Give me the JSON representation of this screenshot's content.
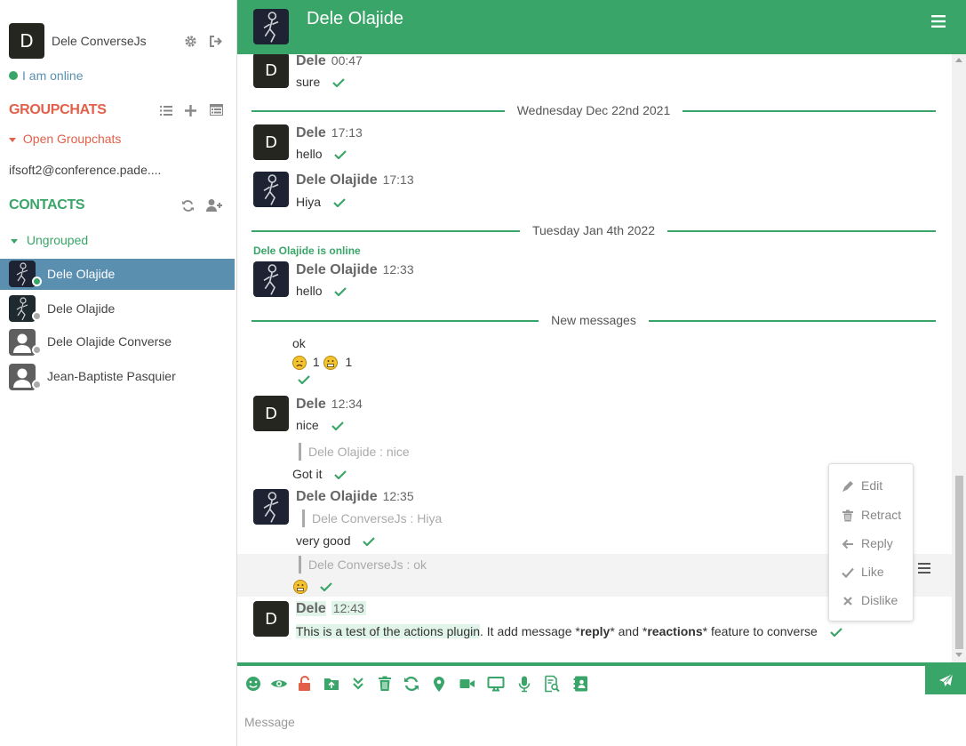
{
  "sidebar": {
    "user": {
      "avatar_letter": "D",
      "name": "Dele ConverseJs"
    },
    "status": {
      "label": "I am online",
      "color": "#3aa569"
    },
    "groupchats": {
      "title": "GROUPCHATS",
      "open_label": "Open Groupchats",
      "rooms": [
        "ifsoft2@conference.pade...."
      ]
    },
    "contacts": {
      "title": "CONTACTS",
      "group_label": "Ungrouped",
      "items": [
        {
          "name": "Dele Olajide",
          "active": true,
          "status": "online"
        },
        {
          "name": "Dele Olajide",
          "active": false,
          "status": "offline"
        },
        {
          "name": "Dele Olajide Converse",
          "active": false,
          "status": "offline"
        },
        {
          "name": "Jean-Baptiste Pasquier",
          "active": false,
          "status": "offline"
        }
      ]
    }
  },
  "chat": {
    "title": "Dele Olajide",
    "messages": {
      "m0": {
        "author": "Dele",
        "time": "00:47",
        "text": "sure"
      },
      "sep1": "Wednesday Dec 22nd 2021",
      "m1": {
        "author": "Dele",
        "time": "17:13",
        "text": "hello"
      },
      "m2": {
        "author": "Dele Olajide",
        "time": "17:13",
        "text": "Hiya"
      },
      "sep2": "Tuesday Jan 4th 2022",
      "presence": "Dele Olajide is online",
      "m3": {
        "author": "Dele Olajide",
        "time": "12:33",
        "text": "hello"
      },
      "sep3": "New messages",
      "m4": {
        "text": "ok",
        "reaction1_count": "1",
        "reaction2_count": "1"
      },
      "m5": {
        "author": "Dele",
        "time": "12:34",
        "text": "nice"
      },
      "m6": {
        "quote": "Dele Olajide : nice",
        "text": "Got it"
      },
      "m7": {
        "author": "Dele Olajide",
        "time": "12:35",
        "quote": "Dele ConverseJs : Hiya",
        "text": "very good"
      },
      "m8": {
        "quote": "Dele ConverseJs : ok"
      },
      "m9": {
        "author": "Dele",
        "time": "12:43",
        "text_a": "This is a test of the actions plugin",
        "text_b": ". It add message *",
        "text_bold1": "reply",
        "text_c": "* and *",
        "text_bold2": "reactions",
        "text_d": "* feature to converse"
      }
    },
    "actions_menu": [
      "Edit",
      "Retract",
      "Reply",
      "Like",
      "Dislike"
    ],
    "input_placeholder": "Message"
  },
  "colors": {
    "accent": "#3aa569",
    "groupchat_title": "#e2604a",
    "contact_active": "#5a8fb0"
  }
}
